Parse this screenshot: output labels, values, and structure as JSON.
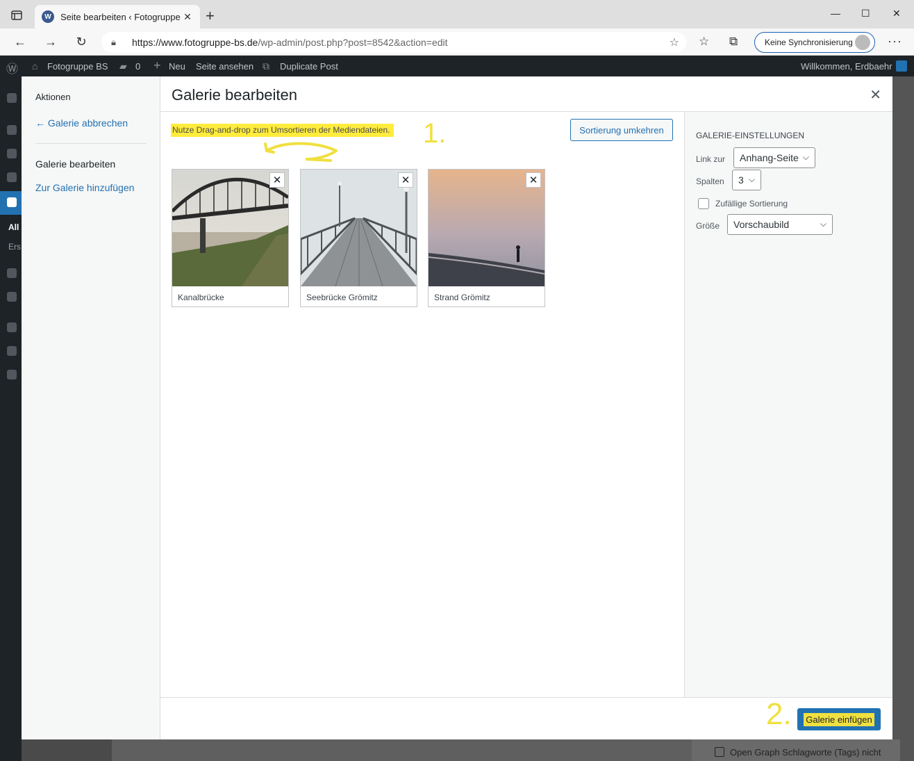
{
  "browser": {
    "tab_title": "Seite bearbeiten ‹ Fotogruppe BS",
    "url_host": "https://www.fotogruppe-bs.de",
    "url_path": "/wp-admin/post.php?post=8542&action=edit",
    "sync_label": "Keine Synchronisierung"
  },
  "adminbar": {
    "site_name": "Fotogruppe BS",
    "comments_count": "0",
    "new_label": "Neu",
    "view_label": "Seite ansehen",
    "duplicate_label": "Duplicate Post",
    "welcome": "Willkommen, Erdbaehr"
  },
  "admin_menu": {
    "sub_all": "All",
    "sub_create": "Ers"
  },
  "modal": {
    "title": "Galerie bearbeiten",
    "menu": {
      "heading": "Aktionen",
      "cancel": "← Galerie abbrechen",
      "edit": "Galerie bearbeiten",
      "add": "Zur Galerie hinzufügen"
    },
    "instruction": "Nutze Drag-and-drop zum Umsortieren der Mediendateien.",
    "annotation_1": "1.",
    "annotation_2": "2.",
    "reverse_button": "Sortierung umkehren",
    "images": [
      {
        "caption": "Kanalbrücke"
      },
      {
        "caption": "Seebrücke Grömitz"
      },
      {
        "caption": "Strand Grömitz"
      }
    ],
    "settings": {
      "heading": "GALERIE-EINSTELLUNGEN",
      "link_label": "Link zur",
      "link_value": "Anhang-Seite",
      "columns_label": "Spalten",
      "columns_value": "3",
      "random_label": "Zufällige Sortierung",
      "size_label": "Größe",
      "size_value": "Vorschaubild"
    },
    "insert_button": "Galerie einfügen"
  },
  "background": {
    "og_tags_label": "Open Graph Schlagworte (Tags) nicht"
  },
  "colors": {
    "accent": "#2271b1",
    "highlight": "#ffec3d",
    "annotation": "#f0e040"
  }
}
